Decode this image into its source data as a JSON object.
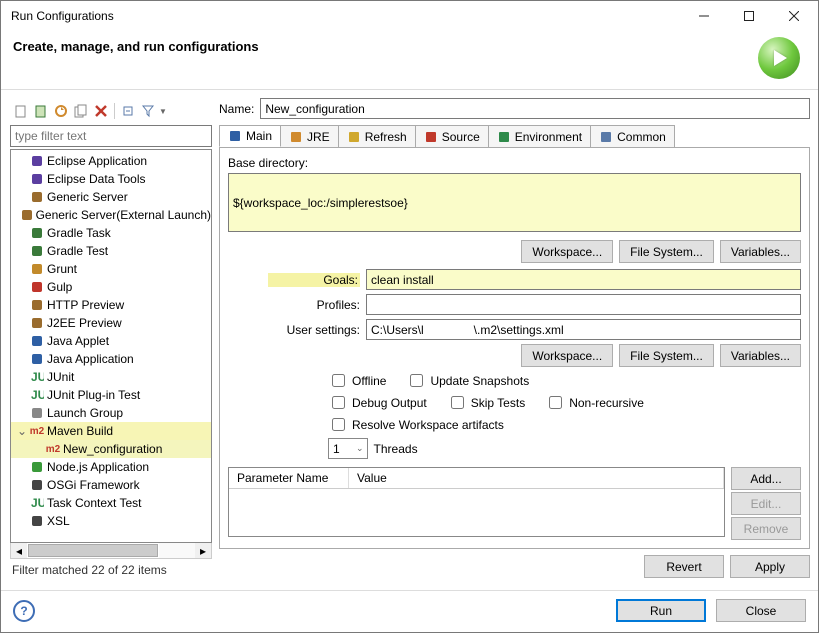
{
  "window": {
    "title": "Run Configurations"
  },
  "header": {
    "text": "Create, manage, and run configurations"
  },
  "sidebar": {
    "filter_placeholder": "type filter text",
    "items": [
      {
        "label": "Eclipse Application",
        "color": "#5b3ea0"
      },
      {
        "label": "Eclipse Data Tools",
        "color": "#5b3ea0"
      },
      {
        "label": "Generic Server",
        "color": "#9a6c2e"
      },
      {
        "label": "Generic Server(External Launch)",
        "color": "#9a6c2e"
      },
      {
        "label": "Gradle Task",
        "color": "#3a7a3a"
      },
      {
        "label": "Gradle Test",
        "color": "#3a7a3a"
      },
      {
        "label": "Grunt",
        "color": "#c28a2b"
      },
      {
        "label": "Gulp",
        "color": "#c0352b"
      },
      {
        "label": "HTTP Preview",
        "color": "#9a6c2e"
      },
      {
        "label": "J2EE Preview",
        "color": "#9a6c2e"
      },
      {
        "label": "Java Applet",
        "color": "#2e5fa4"
      },
      {
        "label": "Java Application",
        "color": "#2e5fa4"
      },
      {
        "label": "JUnit",
        "color": "#2e8a4a",
        "text": "JU"
      },
      {
        "label": "JUnit Plug-in Test",
        "color": "#2e8a4a",
        "text": "JU"
      },
      {
        "label": "Launch Group",
        "color": "#888"
      }
    ],
    "maven": {
      "label": "Maven Build",
      "badge": "m2",
      "child": "New_configuration"
    },
    "items2": [
      {
        "label": "Node.js Application",
        "color": "#3a9a3a"
      },
      {
        "label": "OSGi Framework",
        "color": "#444"
      },
      {
        "label": "Task Context Test",
        "color": "#2e8a4a",
        "text": "JU"
      },
      {
        "label": "XSL",
        "color": "#444"
      }
    ],
    "status": "Filter matched 22 of 22 items"
  },
  "main": {
    "name_label": "Name:",
    "name_value": "New_configuration",
    "tabs": [
      "Main",
      "JRE",
      "Refresh",
      "Source",
      "Environment",
      "Common"
    ],
    "base_dir_label": "Base directory:",
    "base_dir_value": "${workspace_loc:/simplerestsoe}",
    "btn_workspace": "Workspace...",
    "btn_filesystem": "File System...",
    "btn_variables": "Variables...",
    "goals_label": "Goals:",
    "goals_value": "clean install",
    "profiles_label": "Profiles:",
    "profiles_value": "",
    "user_settings_label": "User settings:",
    "user_settings_value": "C:\\Users\\l               \\.m2\\settings.xml",
    "chk_offline": "Offline",
    "chk_update": "Update Snapshots",
    "chk_debug": "Debug Output",
    "chk_skip": "Skip Tests",
    "chk_nonrec": "Non-recursive",
    "chk_resolve": "Resolve Workspace artifacts",
    "threads_label": "Threads",
    "threads_value": "1",
    "table_h1": "Parameter Name",
    "table_h2": "Value",
    "btn_add": "Add...",
    "btn_edit": "Edit...",
    "btn_remove": "Remove",
    "btn_revert": "Revert",
    "btn_apply": "Apply"
  },
  "footer": {
    "run": "Run",
    "close": "Close"
  }
}
